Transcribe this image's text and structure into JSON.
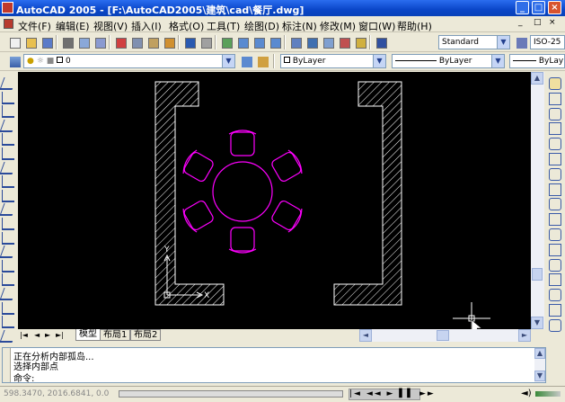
{
  "window": {
    "title": "AutoCAD 2005 - [F:\\AutoCAD2005\\建筑\\cad\\餐厅.dwg]",
    "controls": [
      "_",
      "□",
      "×"
    ]
  },
  "menu": {
    "items": [
      "文件(F)",
      "编辑(E)",
      "视图(V)",
      "插入(I)",
      "格式(O)",
      "工具(T)",
      "绘图(D)",
      "标注(N)",
      "修改(M)",
      "窗口(W)",
      "帮助(H)"
    ],
    "doc_controls": [
      "_",
      "□",
      "×"
    ]
  },
  "standard_toolbar": {
    "icons": [
      "new-icon",
      "open-icon",
      "save-icon",
      "print-icon",
      "preview-icon",
      "publish-icon",
      "cut-icon",
      "copy-icon",
      "paste-icon",
      "matchprop-icon",
      "undo-icon",
      "redo-icon",
      "pan-icon",
      "zoom-realtime-icon",
      "zoom-window-icon",
      "zoom-previous-icon",
      "properties-icon",
      "designcenter-icon",
      "toolpalette-icon",
      "sheetset-icon",
      "markup-icon",
      "help-icon"
    ],
    "text_style": "Standard",
    "dim_style": "ISO-25"
  },
  "layers_toolbar": {
    "layer_value": "0",
    "color_value": "ByLayer",
    "linetype_value": "ByLayer",
    "lineweight_value": "ByLay"
  },
  "tabs": {
    "items": [
      "模型",
      "布局1",
      "布局2"
    ],
    "active": "模型"
  },
  "command": {
    "history": [
      "正在分析内部孤岛...",
      "选择内部点"
    ],
    "prompt": "命令:"
  },
  "status": {
    "coordinates": "598.3470, 2016.6841, 0.0"
  },
  "ucs": {
    "x_label": "X",
    "y_label": "Y"
  },
  "colors": {
    "canvas": "#000000",
    "walls": "#ffffff",
    "furniture": "#ff00ff",
    "titlebar": "#0a46c8"
  }
}
